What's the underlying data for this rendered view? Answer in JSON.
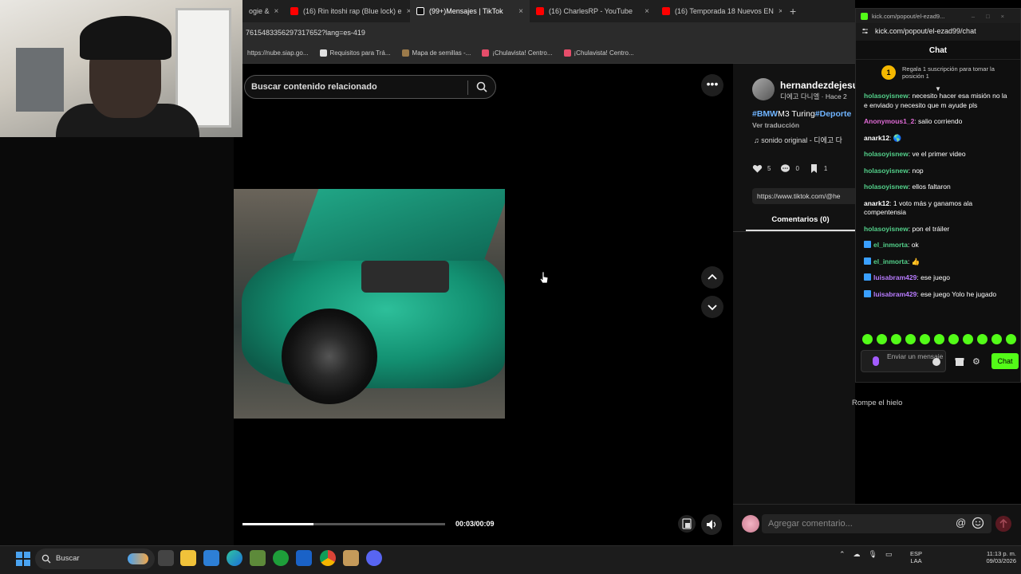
{
  "browser": {
    "tabs": [
      {
        "label": "ogie &",
        "color": "#ff3d3d"
      },
      {
        "label": "(16) Rin itoshi rap (Blue lock) e",
        "color": "#ff0000"
      },
      {
        "label": "(99+)Mensajes | TikTok",
        "color": "#ffffff",
        "active": true
      },
      {
        "label": "(16) CharlesRP - YouTube",
        "color": "#ff0000"
      },
      {
        "label": "(16) Temporada 18 Nuevos EN",
        "color": "#ff0000"
      }
    ],
    "new_tab_glyph": "+",
    "close_glyph": "×",
    "url": "7615483356297317652?lang=es-419",
    "bookmarks": [
      {
        "label": "https://nube.siap.go...",
        "color": "#888888"
      },
      {
        "label": "Requisitos para Trá...",
        "color": "#e0e0e0"
      },
      {
        "label": "Mapa de semillas -...",
        "color": "#9b7a4a"
      },
      {
        "label": "¡Chulavista! Centro...",
        "color": "#e64d6a"
      },
      {
        "label": "¡Chulavista! Centro...",
        "color": "#e64d6a"
      }
    ]
  },
  "tiktok": {
    "search_placeholder": "Buscar contenido relacionado",
    "more_glyph": "•••",
    "video_time": "00:03/00:09",
    "progress": 0.35,
    "post": {
      "username": "hernandezdejesu",
      "subline": "디에고 다니엘 · Hace 2",
      "caption_tag1": "#BMW",
      "caption_mid": "M3 Turing",
      "caption_tag2": "#Deporte",
      "translate": "Ver traducción",
      "sound": "♫  sonido original - 디에고 다",
      "likes": "5",
      "comments": "0",
      "saves": "1",
      "link": "https://www.tiktok.com/@he",
      "comments_tab": "Comentarios (0)"
    },
    "comment_placeholder": "Agregar comentario...",
    "at_glyph": "@",
    "icebreaker": "Rompe el hielo"
  },
  "chat": {
    "titlebar": "kick.com/popout/el-ezad9...",
    "url": "kick.com/popout/el-ezad99/chat",
    "header": "Chat",
    "sub_rank": "1",
    "sub_banner": "Regala 1 suscripción para tomar la posición 1",
    "messages": [
      {
        "user": "holasoyisnew",
        "color": "#53d08a",
        "text": ": necesito hacer esa misión no la e enviado y necesito que m ayude pls",
        "badge": false
      },
      {
        "user": "Anonymous1_2",
        "color": "#e06bd6",
        "text": ": salio corriendo",
        "badge": false
      },
      {
        "user": "anark12",
        "color": "#ffffff",
        "text": ": 🌎",
        "badge": false
      },
      {
        "user": "holasoyisnew",
        "color": "#53d08a",
        "text": ": ve el primer video",
        "badge": false
      },
      {
        "user": "holasoyisnew",
        "color": "#53d08a",
        "text": ": nop",
        "badge": false
      },
      {
        "user": "holasoyisnew",
        "color": "#53d08a",
        "text": ": ellos faltaron",
        "badge": false
      },
      {
        "user": "anark12",
        "color": "#ffffff",
        "text": ": 1 voto más y ganamos ala compentensia",
        "badge": false
      },
      {
        "user": "holasoyisnew",
        "color": "#53d08a",
        "text": ": pon el tráiler",
        "badge": false
      },
      {
        "user": "el_inmorta",
        "color": "#53d08a",
        "text": ": ok",
        "badge": true
      },
      {
        "user": "el_inmorta",
        "color": "#53d08a",
        "text": ": 👍",
        "badge": true
      },
      {
        "user": "luisabram429",
        "color": "#b87cff",
        "text": ": ese juego",
        "badge": true
      },
      {
        "user": "luisabram429",
        "color": "#b87cff",
        "text": ": ese juego Yolo he jugado",
        "badge": true
      }
    ],
    "input_placeholder": "Enviar un mensaje",
    "send_label": "Chat",
    "accent": "#53fc18"
  },
  "taskbar": {
    "search_label": "Buscar",
    "lang": "ESP\nLAA",
    "time": "11:13 p. m.",
    "date": "09/03/2026"
  }
}
